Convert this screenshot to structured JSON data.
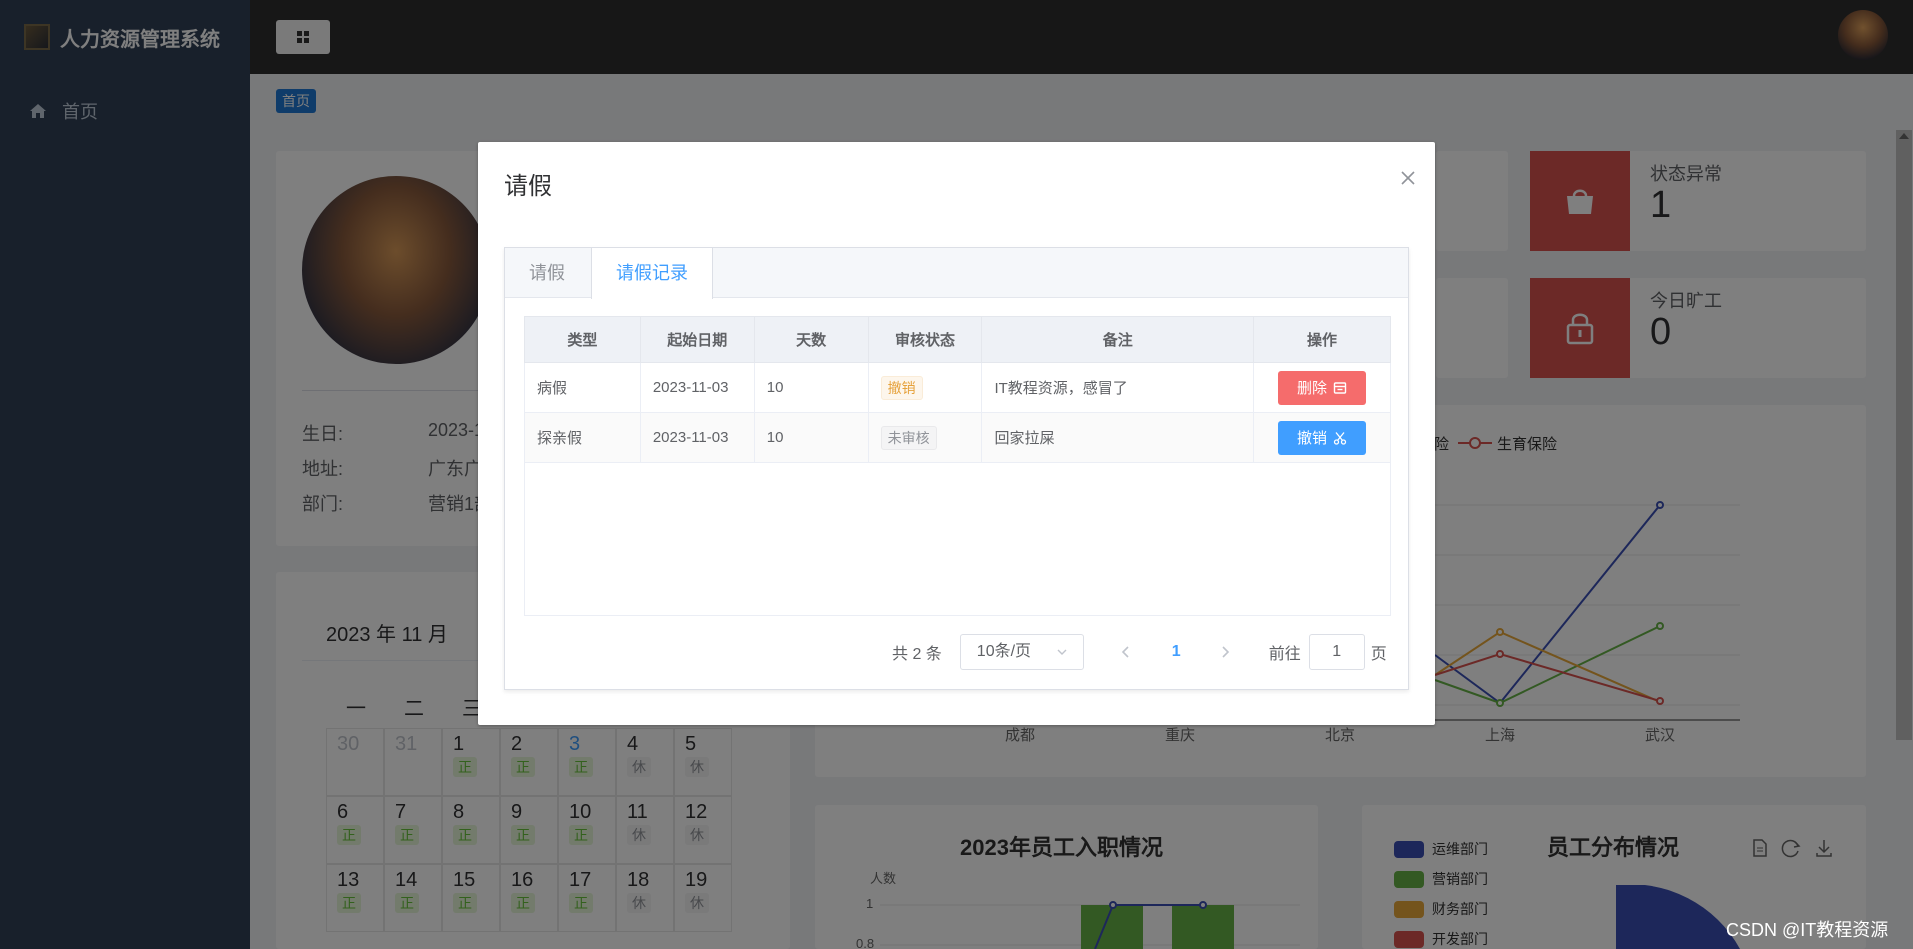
{
  "app": {
    "title": "人力资源管理系统"
  },
  "sidebar": {
    "items": [
      {
        "label": "首页"
      }
    ]
  },
  "breadcrumb": {
    "home": "首页"
  },
  "stats": [
    {
      "label": "状态异常",
      "value": "1"
    },
    {
      "label": "今日旷工",
      "value": "0"
    }
  ],
  "profile": {
    "birthday_label": "生日:",
    "birthday_value": "2023-1",
    "address_label": "地址:",
    "address_value": "广东广",
    "dept_label": "部门:",
    "dept_value": "营销1部"
  },
  "calendar": {
    "title": "2023 年 11 月",
    "weekdays": [
      "一",
      "二",
      "三"
    ],
    "rows": [
      [
        {
          "d": "30",
          "muted": true
        },
        {
          "d": "31",
          "muted": true
        },
        {
          "d": "1",
          "t": "正"
        },
        {
          "d": "2",
          "t": "正"
        },
        {
          "d": "3",
          "t": "正",
          "today": true
        },
        {
          "d": "4",
          "t": "休"
        },
        {
          "d": "5",
          "t": "休"
        }
      ],
      [
        {
          "d": "6",
          "t": "正"
        },
        {
          "d": "7",
          "t": "正"
        },
        {
          "d": "8",
          "t": "正"
        },
        {
          "d": "9",
          "t": "正"
        },
        {
          "d": "10",
          "t": "正"
        },
        {
          "d": "11",
          "t": "休"
        },
        {
          "d": "12",
          "t": "休"
        }
      ],
      [
        {
          "d": "13",
          "t": "正"
        },
        {
          "d": "14",
          "t": "正"
        },
        {
          "d": "15",
          "t": "正"
        },
        {
          "d": "16",
          "t": "正"
        },
        {
          "d": "17",
          "t": "正"
        },
        {
          "d": "18",
          "t": "休"
        },
        {
          "d": "19",
          "t": "休"
        }
      ]
    ]
  },
  "insurance_chart": {
    "legend": [
      "险",
      "生育保险"
    ],
    "x_labels": [
      "成都",
      "重庆",
      "北京",
      "上海",
      "武汉"
    ],
    "colors": [
      "#3a4fb4",
      "#67b346",
      "#e8a83a",
      "#d9534f"
    ]
  },
  "hire_chart": {
    "title": "2023年员工入职情况",
    "ylabel": "人数",
    "ticks": [
      "1",
      "0.8"
    ]
  },
  "dept_chart": {
    "title": "员工分布情况",
    "legend": [
      {
        "name": "运维部门",
        "color": "#3a4fb4"
      },
      {
        "name": "营销部门",
        "color": "#67b346"
      },
      {
        "name": "财务部门",
        "color": "#e8a83a"
      },
      {
        "name": "开发部门",
        "color": "#d9534f"
      }
    ]
  },
  "dialog": {
    "title": "请假",
    "tabs": [
      {
        "label": "请假"
      },
      {
        "label": "请假记录"
      }
    ],
    "table": {
      "headers": [
        "类型",
        "起始日期",
        "天数",
        "审核状态",
        "备注",
        "操作"
      ],
      "rows": [
        {
          "type": "病假",
          "start": "2023-11-03",
          "days": "10",
          "status": "撤销",
          "status_kind": "warn",
          "remark": "IT教程资源，感冒了",
          "action": "删除",
          "action_kind": "red"
        },
        {
          "type": "探亲假",
          "start": "2023-11-03",
          "days": "10",
          "status": "未审核",
          "status_kind": "info",
          "remark": "回家拉屎",
          "action": "撤销",
          "action_kind": "blue"
        }
      ]
    },
    "pagination": {
      "total": "共 2 条",
      "page_size": "10条/页",
      "current": "1",
      "goto_label": "前往",
      "goto_value": "1",
      "page_suffix": "页"
    }
  },
  "watermark": "CSDN @IT教程资源"
}
